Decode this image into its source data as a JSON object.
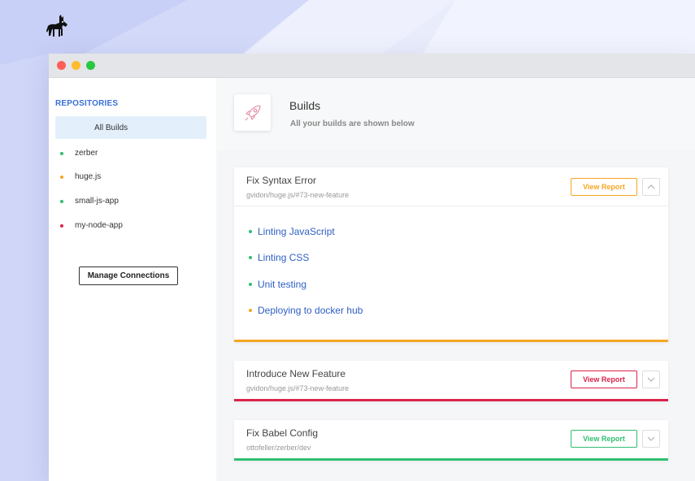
{
  "colors": {
    "red": "#ff5f57",
    "yellow": "#febc2e",
    "green": "#28c840",
    "success": "#2fbf71",
    "warning": "#f5a623",
    "danger": "#d9234b",
    "link": "#2f5fc4"
  },
  "logo": {
    "icon": "donkey-logo"
  },
  "sidebar": {
    "heading": "REPOSITORIES",
    "all_builds": "All Builds",
    "repos": [
      {
        "name": "zerber",
        "status": "success"
      },
      {
        "name": "huge.js",
        "status": "warning"
      },
      {
        "name": "small-js-app",
        "status": "success"
      },
      {
        "name": "my-node-app",
        "status": "danger"
      }
    ],
    "manage_label": "Manage Connections"
  },
  "main": {
    "icon": "rocket-icon",
    "title": "Builds",
    "subtitle": "All your builds are shown below"
  },
  "builds": [
    {
      "title": "Fix Syntax Error",
      "ref": "gvidon/huge.js/#73-new-feature",
      "button": "View Report",
      "status": "warning",
      "expanded": true,
      "steps": [
        {
          "label": "Linting JavaScript",
          "status": "success"
        },
        {
          "label": "Linting CSS",
          "status": "success"
        },
        {
          "label": "Unit testing",
          "status": "success"
        },
        {
          "label": "Deploying to docker hub",
          "status": "warning"
        }
      ]
    },
    {
      "title": "Introduce New Feature",
      "ref": "gvidon/huge.js/#73-new-feature",
      "button": "View Report",
      "status": "danger",
      "expanded": false
    },
    {
      "title": "Fix Babel Config",
      "ref": "ottofeller/zerber/dev",
      "button": "View Report",
      "status": "success",
      "expanded": false
    }
  ]
}
